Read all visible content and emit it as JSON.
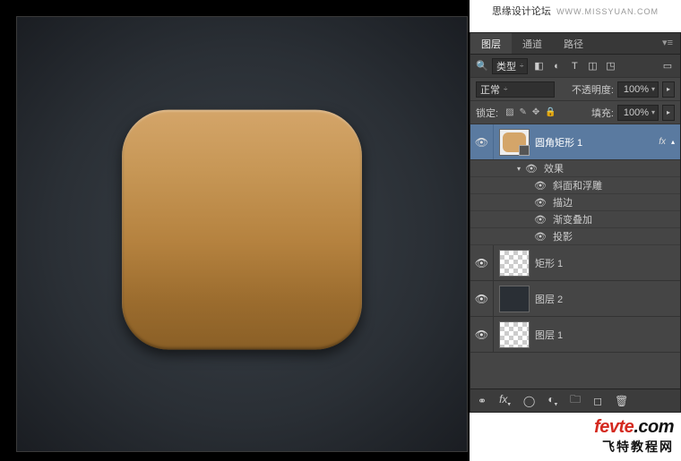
{
  "header": {
    "title": "思缘设计论坛",
    "url": "WWW.MISSYUAN.COM"
  },
  "tabs": {
    "layers": "图层",
    "channels": "通道",
    "paths": "路径"
  },
  "filter": {
    "type": "类型"
  },
  "blend": {
    "mode": "正常",
    "opacity_label": "不透明度:",
    "opacity_value": "100%"
  },
  "lock": {
    "label": "锁定:",
    "fill_label": "填充:",
    "fill_value": "100%"
  },
  "layers": [
    {
      "name": "圆角矩形 1",
      "fx": "fx"
    },
    {
      "name": "矩形 1"
    },
    {
      "name": "图层 2"
    },
    {
      "name": "图层 1"
    }
  ],
  "effects": {
    "title": "效果",
    "items": [
      "斜面和浮雕",
      "描边",
      "渐变叠加",
      "投影"
    ]
  },
  "brand": {
    "line1a": "fevte",
    "line1b": ".com",
    "line2": "飞特教程网"
  }
}
